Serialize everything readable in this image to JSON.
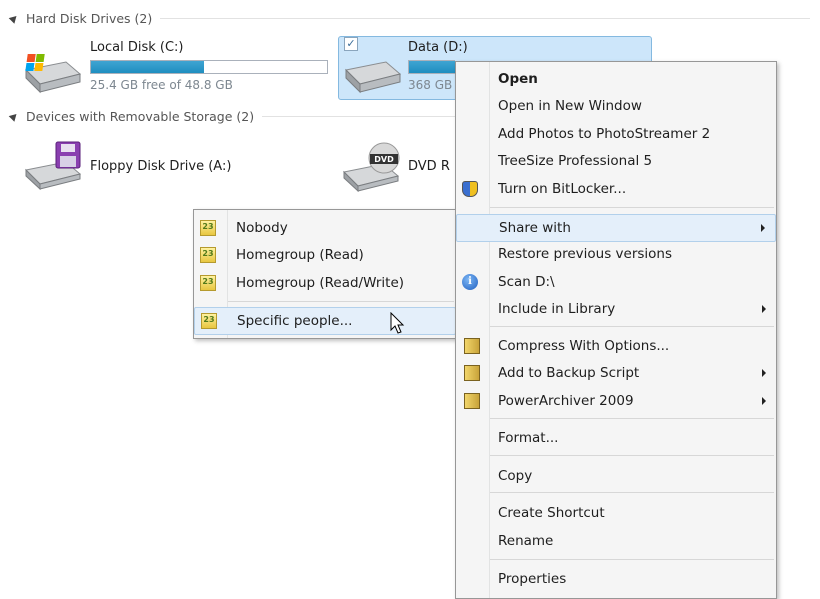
{
  "explorer": {
    "groups": {
      "hard_disks": "Hard Disk Drives (2)",
      "removable": "Devices with Removable Storage (2)"
    },
    "drives": [
      {
        "name": "Local Disk (C:)",
        "free_text": "25.4 GB free of 48.8 GB",
        "used_fraction": 0.48,
        "icon": "windows-hard-drive-icon"
      },
      {
        "name": "Data (D:)",
        "free_text": "368 GB",
        "used_fraction": 0.45,
        "icon": "hard-drive-icon",
        "selected": true,
        "checked": true
      }
    ],
    "devices": [
      {
        "name": "Floppy Disk Drive (A:)",
        "icon": "floppy-drive-icon"
      },
      {
        "name": "DVD R",
        "icon": "dvd-drive-icon",
        "icon_label": "DVD"
      }
    ]
  },
  "context_menu": {
    "items": [
      {
        "label": "Open",
        "bold": true
      },
      {
        "label": "Open in New Window"
      },
      {
        "label": "Add Photos to PhotoStreamer 2"
      },
      {
        "label": "TreeSize Professional 5"
      },
      {
        "label": "Turn on BitLocker...",
        "icon": "uac-shield-icon"
      },
      {
        "label": "Share with",
        "submenu": true,
        "highlighted": true
      },
      {
        "label": "Restore previous versions"
      },
      {
        "label": "Scan D:\\",
        "icon": "info-icon"
      },
      {
        "label": "Include in Library",
        "submenu": true
      },
      {
        "label": "Compress With Options...",
        "icon": "archive-icon"
      },
      {
        "label": "Add to Backup Script",
        "icon": "archive-icon",
        "submenu": true
      },
      {
        "label": "PowerArchiver 2009",
        "icon": "archive-icon",
        "submenu": true
      },
      {
        "label": "Format..."
      },
      {
        "label": "Copy"
      },
      {
        "label": "Create Shortcut"
      },
      {
        "label": "Rename"
      },
      {
        "label": "Properties"
      }
    ]
  },
  "share_submenu": {
    "items": [
      {
        "label": "Nobody",
        "icon": "people-icon",
        "icon_text": "23"
      },
      {
        "label": "Homegroup (Read)",
        "icon": "people-icon",
        "icon_text": "23"
      },
      {
        "label": "Homegroup (Read/Write)",
        "icon": "people-icon",
        "icon_text": "23"
      },
      {
        "label": "Specific people...",
        "icon": "people-icon",
        "icon_text": "23",
        "highlighted": true
      }
    ]
  },
  "colors": {
    "accent": "#1f8ec0",
    "selection": "#cde6fa",
    "menu_bg": "#f5f5f5"
  }
}
